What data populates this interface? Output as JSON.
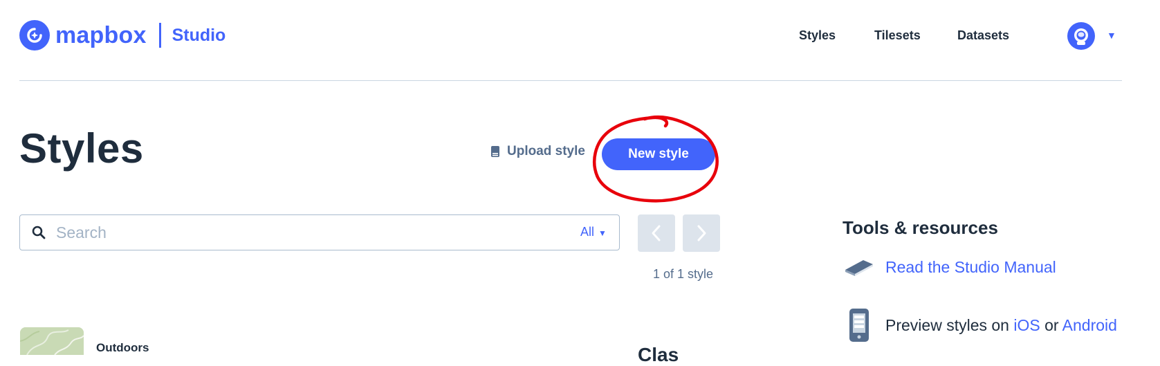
{
  "header": {
    "logo_text": "mapbox",
    "product_name": "Studio",
    "nav": [
      {
        "label": "Styles"
      },
      {
        "label": "Tilesets"
      },
      {
        "label": "Datasets"
      }
    ],
    "account_icon": "astronaut-avatar-icon",
    "account_caret_icon": "caret-down-icon"
  },
  "page": {
    "title": "Styles",
    "upload_label": "Upload style",
    "upload_icon": "upload-drive-icon",
    "new_style_label": "New style",
    "annotation_color": "#e8000b"
  },
  "search": {
    "placeholder": "Search",
    "value": "",
    "filter_label": "All",
    "icon": "search-icon"
  },
  "pagination": {
    "prev_icon": "chevron-left-icon",
    "next_icon": "chevron-right-icon",
    "count_text": "1 of 1 style"
  },
  "styles_list": [
    {
      "name": "Outdoors"
    }
  ],
  "partial_heading": "Clas",
  "sidebar": {
    "title": "Tools & resources",
    "manual_link": "Read the Studio Manual",
    "manual_icon": "book-icon",
    "preview_prefix": "Preview styles on ",
    "preview_ios": "iOS",
    "preview_or": " or ",
    "preview_android": "Android",
    "preview_icon": "phone-icon"
  },
  "colors": {
    "brand": "#4264fb",
    "text_dark": "#1f2d3d",
    "text_muted": "#546c8c",
    "pager_bg": "#dde4ec"
  }
}
